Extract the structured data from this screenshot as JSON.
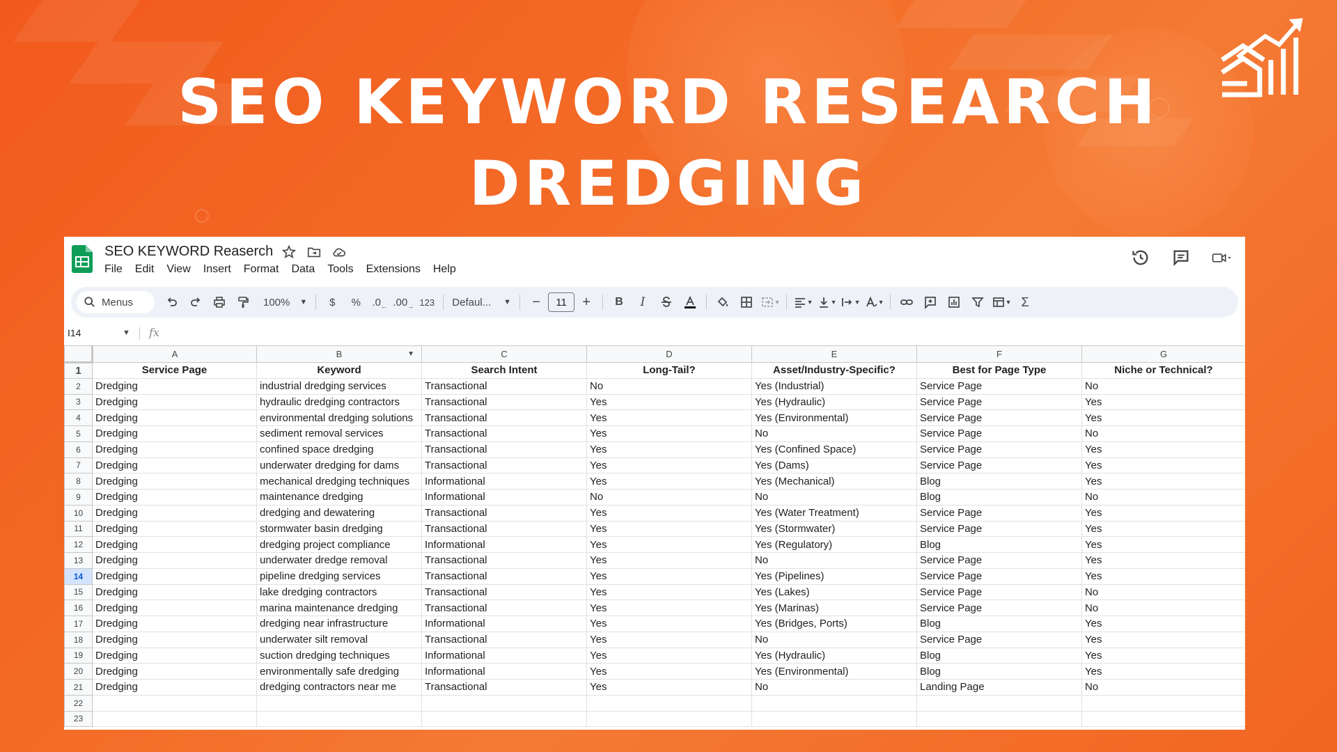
{
  "headline": {
    "line1": "SEO KEYWORD RESEARCH",
    "line2": "DREDGING"
  },
  "doc": {
    "title": "SEO KEYWORD Reaserch",
    "menus": [
      "File",
      "Edit",
      "View",
      "Insert",
      "Format",
      "Data",
      "Tools",
      "Extensions",
      "Help"
    ]
  },
  "toolbar": {
    "search_label": "Menus",
    "zoom": "100%",
    "currency": "$",
    "percent": "%",
    "dec_decrease": ".0",
    "dec_increase": ".00",
    "number_format": "123",
    "font": "Defaul...",
    "font_size": "11",
    "minus": "−",
    "plus": "+",
    "bold": "B",
    "italic": "I",
    "sum": "Σ"
  },
  "formula_bar": {
    "cell_ref": "I14",
    "fx": "fx"
  },
  "colors": {
    "background": "#f26522",
    "sheets_green": "#0f9d58",
    "selected_row": "#d3e3fd"
  },
  "grid": {
    "columns": [
      "A",
      "B",
      "C",
      "D",
      "E",
      "F",
      "G"
    ],
    "active_row": 14,
    "header": [
      "Service Page",
      "Keyword",
      "Search Intent",
      "Long-Tail?",
      "Asset/Industry-Specific?",
      "Best for Page Type",
      "Niche or Technical?"
    ],
    "rows": [
      [
        "Dredging",
        "industrial dredging services",
        "Transactional",
        "No",
        "Yes (Industrial)",
        "Service Page",
        "No"
      ],
      [
        "Dredging",
        "hydraulic dredging contractors",
        "Transactional",
        "Yes",
        "Yes (Hydraulic)",
        "Service Page",
        "Yes"
      ],
      [
        "Dredging",
        "environmental dredging solutions",
        "Transactional",
        "Yes",
        "Yes (Environmental)",
        "Service Page",
        "Yes"
      ],
      [
        "Dredging",
        "sediment removal services",
        "Transactional",
        "Yes",
        "No",
        "Service Page",
        "No"
      ],
      [
        "Dredging",
        "confined space dredging",
        "Transactional",
        "Yes",
        "Yes (Confined Space)",
        "Service Page",
        "Yes"
      ],
      [
        "Dredging",
        "underwater dredging for dams",
        "Transactional",
        "Yes",
        "Yes (Dams)",
        "Service Page",
        "Yes"
      ],
      [
        "Dredging",
        "mechanical dredging techniques",
        "Informational",
        "Yes",
        "Yes (Mechanical)",
        "Blog",
        "Yes"
      ],
      [
        "Dredging",
        "maintenance dredging",
        "Informational",
        "No",
        "No",
        "Blog",
        "No"
      ],
      [
        "Dredging",
        "dredging and dewatering",
        "Transactional",
        "Yes",
        "Yes (Water Treatment)",
        "Service Page",
        "Yes"
      ],
      [
        "Dredging",
        "stormwater basin dredging",
        "Transactional",
        "Yes",
        "Yes (Stormwater)",
        "Service Page",
        "Yes"
      ],
      [
        "Dredging",
        "dredging project compliance",
        "Informational",
        "Yes",
        "Yes (Regulatory)",
        "Blog",
        "Yes"
      ],
      [
        "Dredging",
        "underwater dredge removal",
        "Transactional",
        "Yes",
        "No",
        "Service Page",
        "Yes"
      ],
      [
        "Dredging",
        "pipeline dredging services",
        "Transactional",
        "Yes",
        "Yes (Pipelines)",
        "Service Page",
        "Yes"
      ],
      [
        "Dredging",
        "lake dredging contractors",
        "Transactional",
        "Yes",
        "Yes (Lakes)",
        "Service Page",
        "No"
      ],
      [
        "Dredging",
        "marina maintenance dredging",
        "Transactional",
        "Yes",
        "Yes (Marinas)",
        "Service Page",
        "No"
      ],
      [
        "Dredging",
        "dredging near infrastructure",
        "Informational",
        "Yes",
        "Yes (Bridges, Ports)",
        "Blog",
        "Yes"
      ],
      [
        "Dredging",
        "underwater silt removal",
        "Transactional",
        "Yes",
        "No",
        "Service Page",
        "Yes"
      ],
      [
        "Dredging",
        "suction dredging techniques",
        "Informational",
        "Yes",
        "Yes (Hydraulic)",
        "Blog",
        "Yes"
      ],
      [
        "Dredging",
        "environmentally safe dredging",
        "Informational",
        "Yes",
        "Yes (Environmental)",
        "Blog",
        "Yes"
      ],
      [
        "Dredging",
        "dredging contractors near me",
        "Transactional",
        "Yes",
        "No",
        "Landing Page",
        "No"
      ]
    ],
    "empty_rows": [
      22,
      23
    ]
  }
}
